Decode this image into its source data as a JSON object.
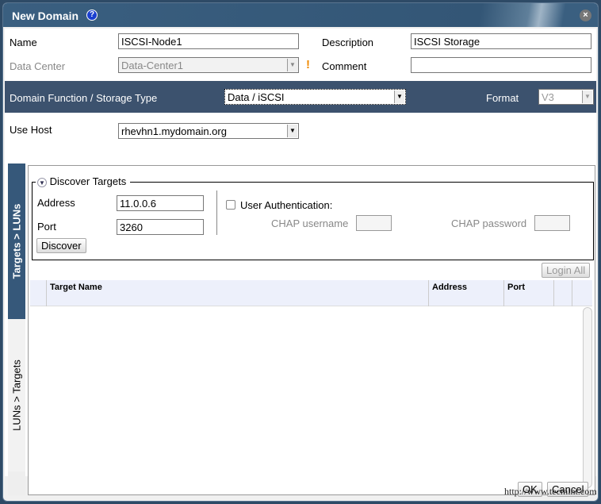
{
  "dialog": {
    "title": "New Domain",
    "help_icon": "?",
    "close_icon": "×"
  },
  "form": {
    "name_label": "Name",
    "name_value": "ISCSI-Node1",
    "description_label": "Description",
    "description_value": "ISCSI Storage",
    "data_center_label": "Data Center",
    "data_center_value": "Data-Center1",
    "warning": "!",
    "comment_label": "Comment",
    "comment_value": "",
    "domain_function_label": "Domain Function / Storage Type",
    "domain_function_value": "Data / iSCSI",
    "format_label": "Format",
    "format_value": "V3",
    "use_host_label": "Use Host",
    "use_host_value": "rhevhn1.mydomain.org"
  },
  "tabs": [
    "Targets > LUNs",
    "LUNs > Targets"
  ],
  "discover": {
    "legend": "Discover Targets",
    "address_label": "Address",
    "address_value": "11.0.0.6",
    "port_label": "Port",
    "port_value": "3260",
    "discover_button": "Discover",
    "user_auth_label": "User Authentication:",
    "chap_username_label": "CHAP username",
    "chap_password_label": "CHAP password"
  },
  "login_all": "Login All",
  "table": {
    "columns": [
      "Target Name",
      "Address",
      "Port"
    ]
  },
  "footer": {
    "ok": "OK",
    "cancel": "Cancel"
  },
  "watermark": "http://www.tecmint.com"
}
